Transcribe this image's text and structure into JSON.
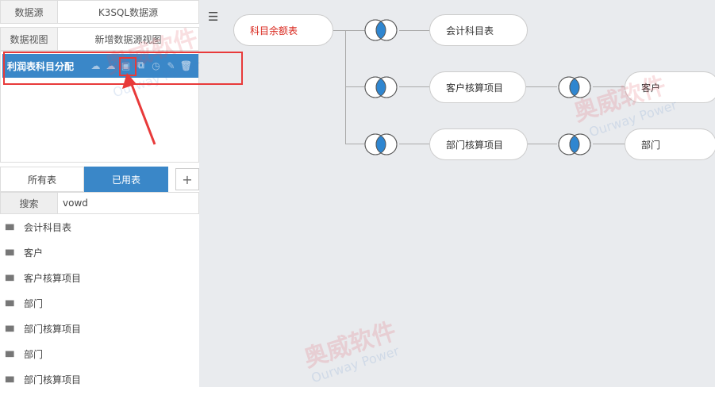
{
  "datasource": {
    "label": "数据源",
    "value": "K3SQL数据源"
  },
  "dataview": {
    "label": "数据视图",
    "new_label": "新增数据源视图"
  },
  "selected_view": {
    "name": "利润表科目分配"
  },
  "tabs": {
    "all": "所有表",
    "used": "已用表",
    "add": "+"
  },
  "search": {
    "label": "搜索",
    "value": "vowd"
  },
  "tables": [
    {
      "label": "会计科目表"
    },
    {
      "label": "客户"
    },
    {
      "label": "客户核算项目"
    },
    {
      "label": "部门"
    },
    {
      "label": "部门核算项目"
    },
    {
      "label": "部门"
    },
    {
      "label": "部门核算项目"
    }
  ],
  "diagram": {
    "root": "科目余额表",
    "n1": "会计科目表",
    "n2": "客户核算项目",
    "n3": "部门核算项目",
    "n4": "客户",
    "n5": "部门"
  },
  "watermark": {
    "cn": "奥威软件",
    "en": "Ourway Power"
  },
  "colors": {
    "accent": "#3a87c8",
    "highlight": "#e83a3a",
    "join": "#2f86d0"
  }
}
